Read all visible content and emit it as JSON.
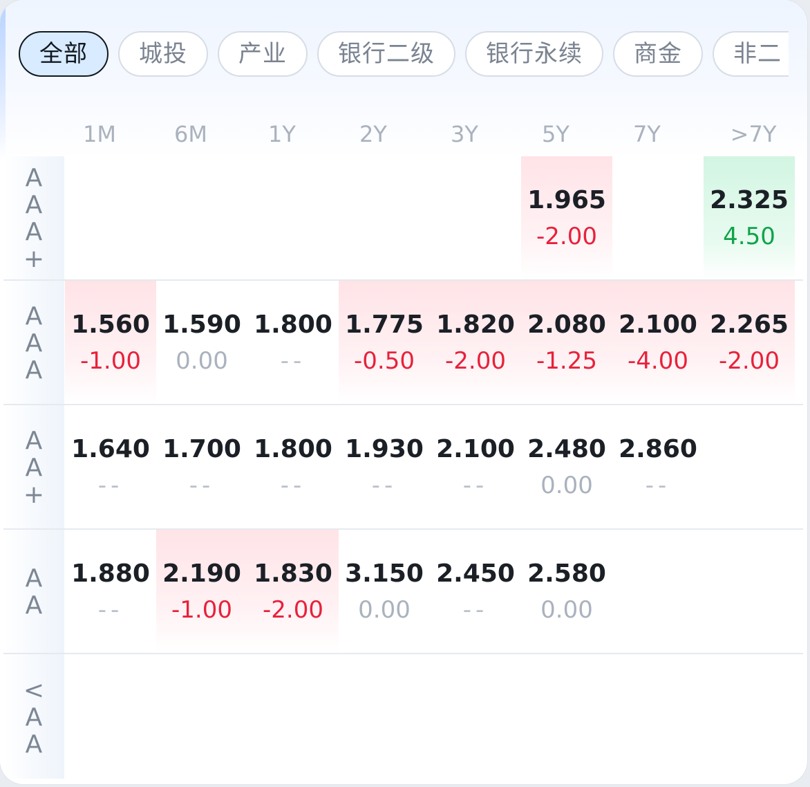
{
  "tabs": [
    {
      "label": "全部",
      "active": true
    },
    {
      "label": "城投",
      "active": false
    },
    {
      "label": "产业",
      "active": false
    },
    {
      "label": "银行二级",
      "active": false
    },
    {
      "label": "银行永续",
      "active": false
    },
    {
      "label": "商金",
      "active": false
    },
    {
      "label": "非二",
      "active": false
    }
  ],
  "columns": [
    "1M",
    "6M",
    "1Y",
    "2Y",
    "3Y",
    "5Y",
    "7Y",
    ">7Y"
  ],
  "rows": [
    {
      "rating": "AAA+",
      "cells": [
        null,
        null,
        null,
        null,
        null,
        {
          "value": "1.965",
          "change": "-2.00",
          "tone": "neg",
          "bg": "red"
        },
        null,
        {
          "value": "2.325",
          "change": "4.50",
          "tone": "pos",
          "bg": "green"
        }
      ]
    },
    {
      "rating": "AAA",
      "cells": [
        {
          "value": "1.560",
          "change": "-1.00",
          "tone": "neg",
          "bg": "red"
        },
        {
          "value": "1.590",
          "change": "0.00",
          "tone": "zero",
          "bg": ""
        },
        {
          "value": "1.800",
          "change": "--",
          "tone": "dash",
          "bg": ""
        },
        {
          "value": "1.775",
          "change": "-0.50",
          "tone": "neg",
          "bg": "red"
        },
        {
          "value": "1.820",
          "change": "-2.00",
          "tone": "neg",
          "bg": "red"
        },
        {
          "value": "2.080",
          "change": "-1.25",
          "tone": "neg",
          "bg": "red"
        },
        {
          "value": "2.100",
          "change": "-4.00",
          "tone": "neg",
          "bg": "red"
        },
        {
          "value": "2.265",
          "change": "-2.00",
          "tone": "neg",
          "bg": "red"
        }
      ]
    },
    {
      "rating": "AA+",
      "cells": [
        {
          "value": "1.640",
          "change": "--",
          "tone": "dash",
          "bg": ""
        },
        {
          "value": "1.700",
          "change": "--",
          "tone": "dash",
          "bg": ""
        },
        {
          "value": "1.800",
          "change": "--",
          "tone": "dash",
          "bg": ""
        },
        {
          "value": "1.930",
          "change": "--",
          "tone": "dash",
          "bg": ""
        },
        {
          "value": "2.100",
          "change": "--",
          "tone": "dash",
          "bg": ""
        },
        {
          "value": "2.480",
          "change": "0.00",
          "tone": "zero",
          "bg": ""
        },
        {
          "value": "2.860",
          "change": "--",
          "tone": "dash",
          "bg": ""
        },
        null
      ]
    },
    {
      "rating": "AA",
      "cells": [
        {
          "value": "1.880",
          "change": "--",
          "tone": "dash",
          "bg": ""
        },
        {
          "value": "2.190",
          "change": "-1.00",
          "tone": "neg",
          "bg": "red"
        },
        {
          "value": "1.830",
          "change": "-2.00",
          "tone": "neg",
          "bg": "red"
        },
        {
          "value": "3.150",
          "change": "0.00",
          "tone": "zero",
          "bg": ""
        },
        {
          "value": "2.450",
          "change": "--",
          "tone": "dash",
          "bg": ""
        },
        {
          "value": "2.580",
          "change": "0.00",
          "tone": "zero",
          "bg": ""
        },
        null,
        null
      ]
    },
    {
      "rating": "<AA",
      "cells": [
        null,
        null,
        null,
        null,
        null,
        null,
        null,
        null
      ]
    }
  ],
  "colors": {
    "negative": "#e8213b",
    "positive": "#10a34a",
    "neutral": "#aab2be",
    "active_tab_bg": "#d8ebff"
  }
}
